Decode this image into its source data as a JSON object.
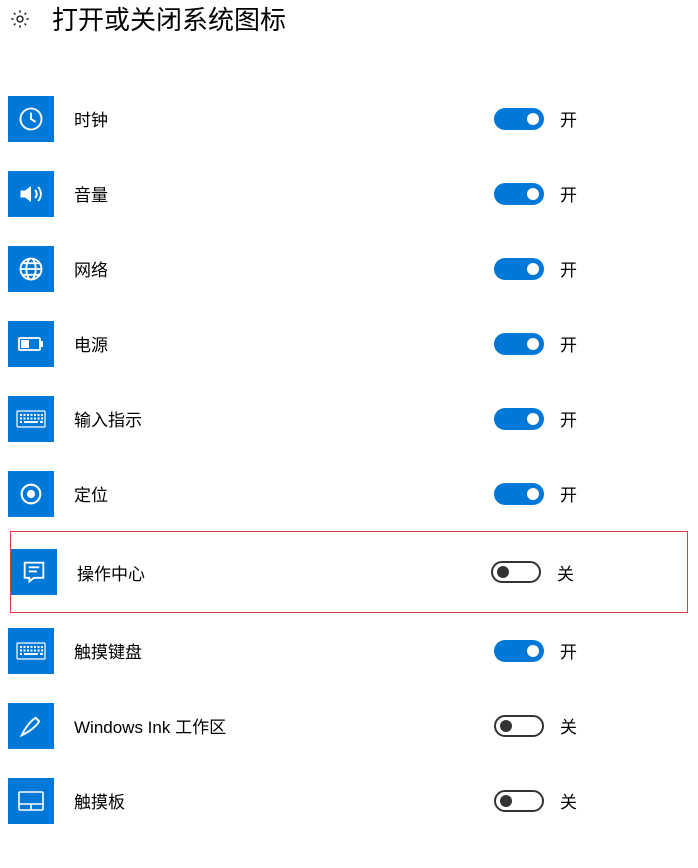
{
  "header": {
    "title": "打开或关闭系统图标"
  },
  "states": {
    "on": "开",
    "off": "关"
  },
  "items": [
    {
      "icon": "clock-icon",
      "label": "时钟",
      "on": true,
      "highlighted": false
    },
    {
      "icon": "volume-icon",
      "label": "音量",
      "on": true,
      "highlighted": false
    },
    {
      "icon": "network-icon",
      "label": "网络",
      "on": true,
      "highlighted": false
    },
    {
      "icon": "power-icon",
      "label": "电源",
      "on": true,
      "highlighted": false
    },
    {
      "icon": "input-indicator-icon",
      "label": "输入指示",
      "on": true,
      "highlighted": false
    },
    {
      "icon": "location-icon",
      "label": "定位",
      "on": true,
      "highlighted": false
    },
    {
      "icon": "action-center-icon",
      "label": "操作中心",
      "on": false,
      "highlighted": true
    },
    {
      "icon": "touch-keyboard-icon",
      "label": "触摸键盘",
      "on": true,
      "highlighted": false
    },
    {
      "icon": "windows-ink-icon",
      "label": "Windows Ink 工作区",
      "on": false,
      "highlighted": false
    },
    {
      "icon": "touchpad-icon",
      "label": "触摸板",
      "on": false,
      "highlighted": false
    }
  ]
}
